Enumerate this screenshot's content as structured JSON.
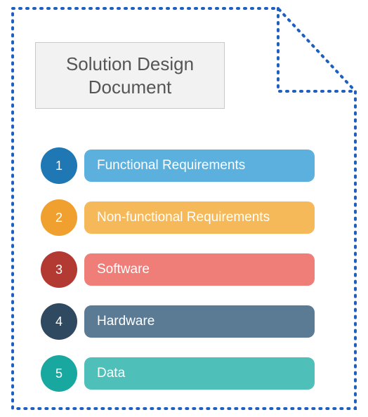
{
  "title": "Solution Design Document",
  "border_color": "#1f5fbf",
  "items": [
    {
      "num": "1",
      "label": "Functional Requirements",
      "badge_color": "#1f77b4",
      "bar_color": "#5bb0de"
    },
    {
      "num": "2",
      "label": "Non-functional Requirements",
      "badge_color": "#f0a02e",
      "bar_color": "#f5b95a"
    },
    {
      "num": "3",
      "label": "Software",
      "badge_color": "#b23a33",
      "bar_color": "#ef7d78"
    },
    {
      "num": "4",
      "label": "Hardware",
      "badge_color": "#2f4a60",
      "bar_color": "#5b7a94"
    },
    {
      "num": "5",
      "label": "Data",
      "badge_color": "#18a8a0",
      "bar_color": "#4ebfb9"
    }
  ]
}
